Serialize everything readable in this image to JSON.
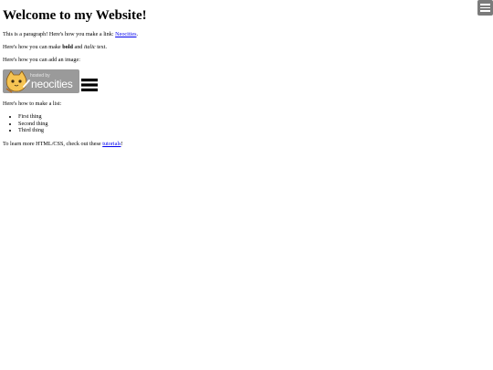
{
  "heading": "Welcome to my Website!",
  "paragraph1": {
    "before": "This is a paragraph! Here's how you make a link: ",
    "link_text": "Neocities",
    "after": "."
  },
  "paragraph2": {
    "before": "Here's how you can make ",
    "bold": "bold",
    "middle": " and ",
    "italic": "italic",
    "after": " text."
  },
  "paragraph3": "Here's how you can add an image:",
  "badge": {
    "hosted_text": "hosted by",
    "brand_text": "neocities"
  },
  "paragraph4": "Here's how to make a list:",
  "list_items": [
    "First thing",
    "Second thing",
    "Third thing"
  ],
  "paragraph5": {
    "before": "To learn more HTML/CSS, check out these ",
    "link_text": "tutorials",
    "after": "!"
  },
  "colors": {
    "link": "#0000ee",
    "menu_button": "#7b7b7b",
    "badge_bg": "#9a9a9a"
  },
  "icons": {
    "corner_menu": "hamburger-menu-icon",
    "inline_menu": "hamburger-menu-icon",
    "badge_mascot": "neocities-cat-icon"
  }
}
